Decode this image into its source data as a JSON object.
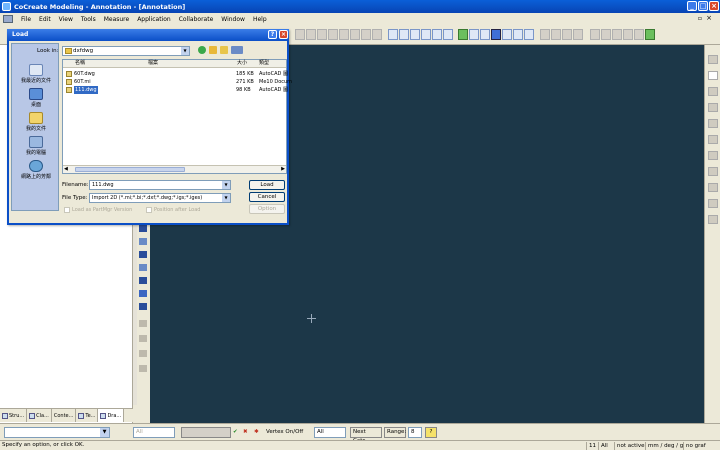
{
  "window": {
    "title": "CoCreate Modeling - Annotation - [Annotation]",
    "controls": [
      "_",
      "□",
      "×"
    ]
  },
  "menu": {
    "items": [
      "File",
      "Edit",
      "View",
      "Tools",
      "Measure",
      "Application",
      "Collaborate",
      "Window",
      "Help"
    ],
    "restore": "▫",
    "close": "×"
  },
  "left_panel": {
    "tabs": [
      "Stru...",
      "Cla...",
      "Conte...",
      "Te...",
      "Dra..."
    ]
  },
  "dialog": {
    "title": "Load",
    "help": "?",
    "close": "×",
    "look_in_label": "Look in:",
    "look_in_value": "dxfdwg",
    "places": [
      "我最近的文件",
      "桌面",
      "我的文件",
      "我的電腦",
      "網路上的芳鄰"
    ],
    "columns": {
      "name": "名稱",
      "type_blank": "檔案",
      "size": "大小",
      "type": "類型"
    },
    "files": [
      {
        "name": "60T.dwg",
        "size": "185 KB",
        "type": "AutoCAD 圖"
      },
      {
        "name": "60T.mi",
        "size": "271 KB",
        "type": "Me10 Docum"
      },
      {
        "name": "111.dwg",
        "size": "98 KB",
        "type": "AutoCAD 圖"
      }
    ],
    "filename_label": "Filename:",
    "filename_value": "111.dwg",
    "filetype_label": "File Type:",
    "filetype_value": "Import 2D (*.mi;*.bi;*.dxf;*.dwg;*.igs;*.iges)",
    "load_button": "Load",
    "cancel_button": "Cancel",
    "options_button": "Option",
    "check_partmgr": "Load as PartMgr Version",
    "check_position": "Position after Load"
  },
  "bottom": {
    "all_left": "All",
    "vertex_label": "Vertex On/Off",
    "all_right": "All",
    "next_catc": "Next Catc",
    "range_label": "Range:",
    "range_value": "8",
    "help_button": "?"
  },
  "status": {
    "message": "Specify an option, or click OK.",
    "cells": [
      "11",
      "All",
      "not active",
      "mm / deg / g",
      "no graf"
    ]
  }
}
